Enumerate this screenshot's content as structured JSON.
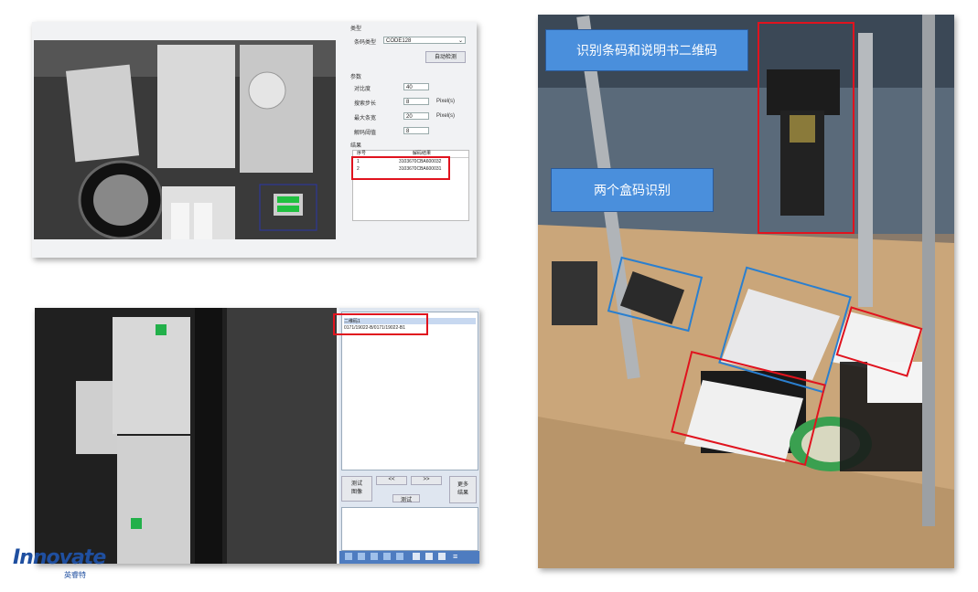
{
  "top_ui": {
    "section_type": "类型",
    "barcode_type_label": "条码类型",
    "barcode_type_value": "CODE128",
    "auto_detect_button": "自动检测",
    "section_params": "参数",
    "params": [
      {
        "label": "对比度",
        "value": "40",
        "unit": ""
      },
      {
        "label": "搜索步长",
        "value": "8",
        "unit": "Pixel(s)"
      },
      {
        "label": "最大条宽",
        "value": "20",
        "unit": "Pixel(s)"
      },
      {
        "label": "解码阈值",
        "value": "8",
        "unit": ""
      }
    ],
    "section_results": "结果",
    "results_headers": [
      "序号",
      "解码结果"
    ],
    "results_rows": [
      {
        "index": "1",
        "value": "3103670CBA600032"
      },
      {
        "index": "2",
        "value": "3103670CBA600031"
      }
    ]
  },
  "bottom_ui": {
    "list_header": "二维码1",
    "list_item": "0171/19022-B/0171/19022-B1",
    "prev_button": "<<",
    "next_button": ">>",
    "test_image_button": "测试\n图像",
    "test_button": "测试",
    "side_button": "更多\n结果"
  },
  "photo": {
    "callout_top": "识别条码和说明书二维码",
    "callout_mid": "两个盒码识别"
  },
  "logo": {
    "brand": "Innovate",
    "brand_cn": "英睿特"
  },
  "colors": {
    "highlight_red": "#e0131e",
    "highlight_blue": "#2a7fcf",
    "callout_fill": "#4a8fdc",
    "brand_blue": "#1f4fa0"
  }
}
